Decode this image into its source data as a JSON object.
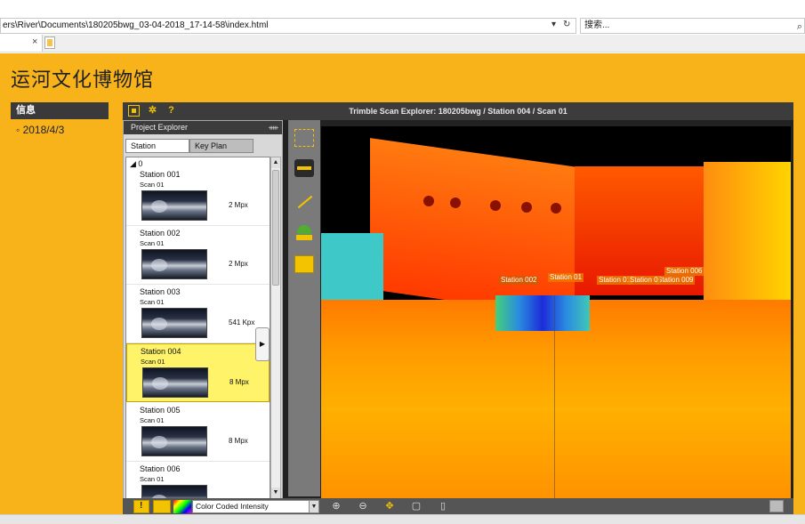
{
  "browser": {
    "address": "ers\\River\\Documents\\180205bwg_03-04-2018_17-14-58\\index.html",
    "address_icons": [
      "dropdown-icon",
      "refresh-icon"
    ],
    "search_placeholder": "搜索...",
    "tab_close": "×"
  },
  "page": {
    "title": "运河文化博物馆",
    "info_header": "信息",
    "info_date": "◦ 2018/4/3"
  },
  "viewer": {
    "title": "Trimble Scan Explorer: 180205bwg / Station 004 / Scan 01",
    "project_explorer": {
      "header": "Project Explorer",
      "tabs": [
        "Station",
        "Key Plan"
      ],
      "root": "0",
      "stations": [
        {
          "name": "Station 001",
          "scan": "Scan 01",
          "size": "2 Mpx"
        },
        {
          "name": "Station 002",
          "scan": "Scan 01",
          "size": "2 Mpx"
        },
        {
          "name": "Station 003",
          "scan": "Scan 01",
          "size": "541 Kpx"
        },
        {
          "name": "Station 004",
          "scan": "Scan 01",
          "size": "8 Mpx"
        },
        {
          "name": "Station 005",
          "scan": "Scan 01",
          "size": "8 Mpx"
        },
        {
          "name": "Station 006",
          "scan": "Scan 01",
          "size": ""
        }
      ],
      "selected_index": 3
    },
    "scan_labels": [
      "Station 006",
      "Station 009",
      "Station 002",
      "Station 01",
      "Station 01",
      "Station 0"
    ],
    "color_mode": "Color Coded Intensity",
    "colors": {
      "accent": "#f3c200",
      "page_bg": "#f8b31a",
      "panel_dark": "#3c3c3c"
    }
  }
}
